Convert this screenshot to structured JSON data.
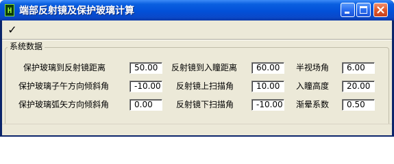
{
  "window": {
    "title": "端部反射镜及保护玻璃计算",
    "icon": "app-logo-icon",
    "icon_glyph": "H"
  },
  "toolbar": {
    "check_symbol": "✓",
    "check_icon": "checkmark-icon"
  },
  "group": {
    "title": "系统数据"
  },
  "fields": [
    {
      "label": "保护玻璃到反射镜距离",
      "value": "50.00"
    },
    {
      "label": "反射镜到入瞳距离",
      "value": "60.00"
    },
    {
      "label": "半视场角",
      "value": "6.00"
    },
    {
      "label": "保护玻璃子午方向倾斜角",
      "value": "-10.00"
    },
    {
      "label": "反射镜上扫描角",
      "value": "10.00"
    },
    {
      "label": "入瞳高度",
      "value": "20.00"
    },
    {
      "label": "保护玻璃弧矢方向倾斜角",
      "value": "0.00"
    },
    {
      "label": "反射镜下扫描角",
      "value": "-10.00"
    },
    {
      "label": "渐晕系数",
      "value": "0.50"
    }
  ],
  "colors": {
    "titlebar": "#0250d8",
    "client": "#ece9d8",
    "close_button": "#e0582a"
  }
}
